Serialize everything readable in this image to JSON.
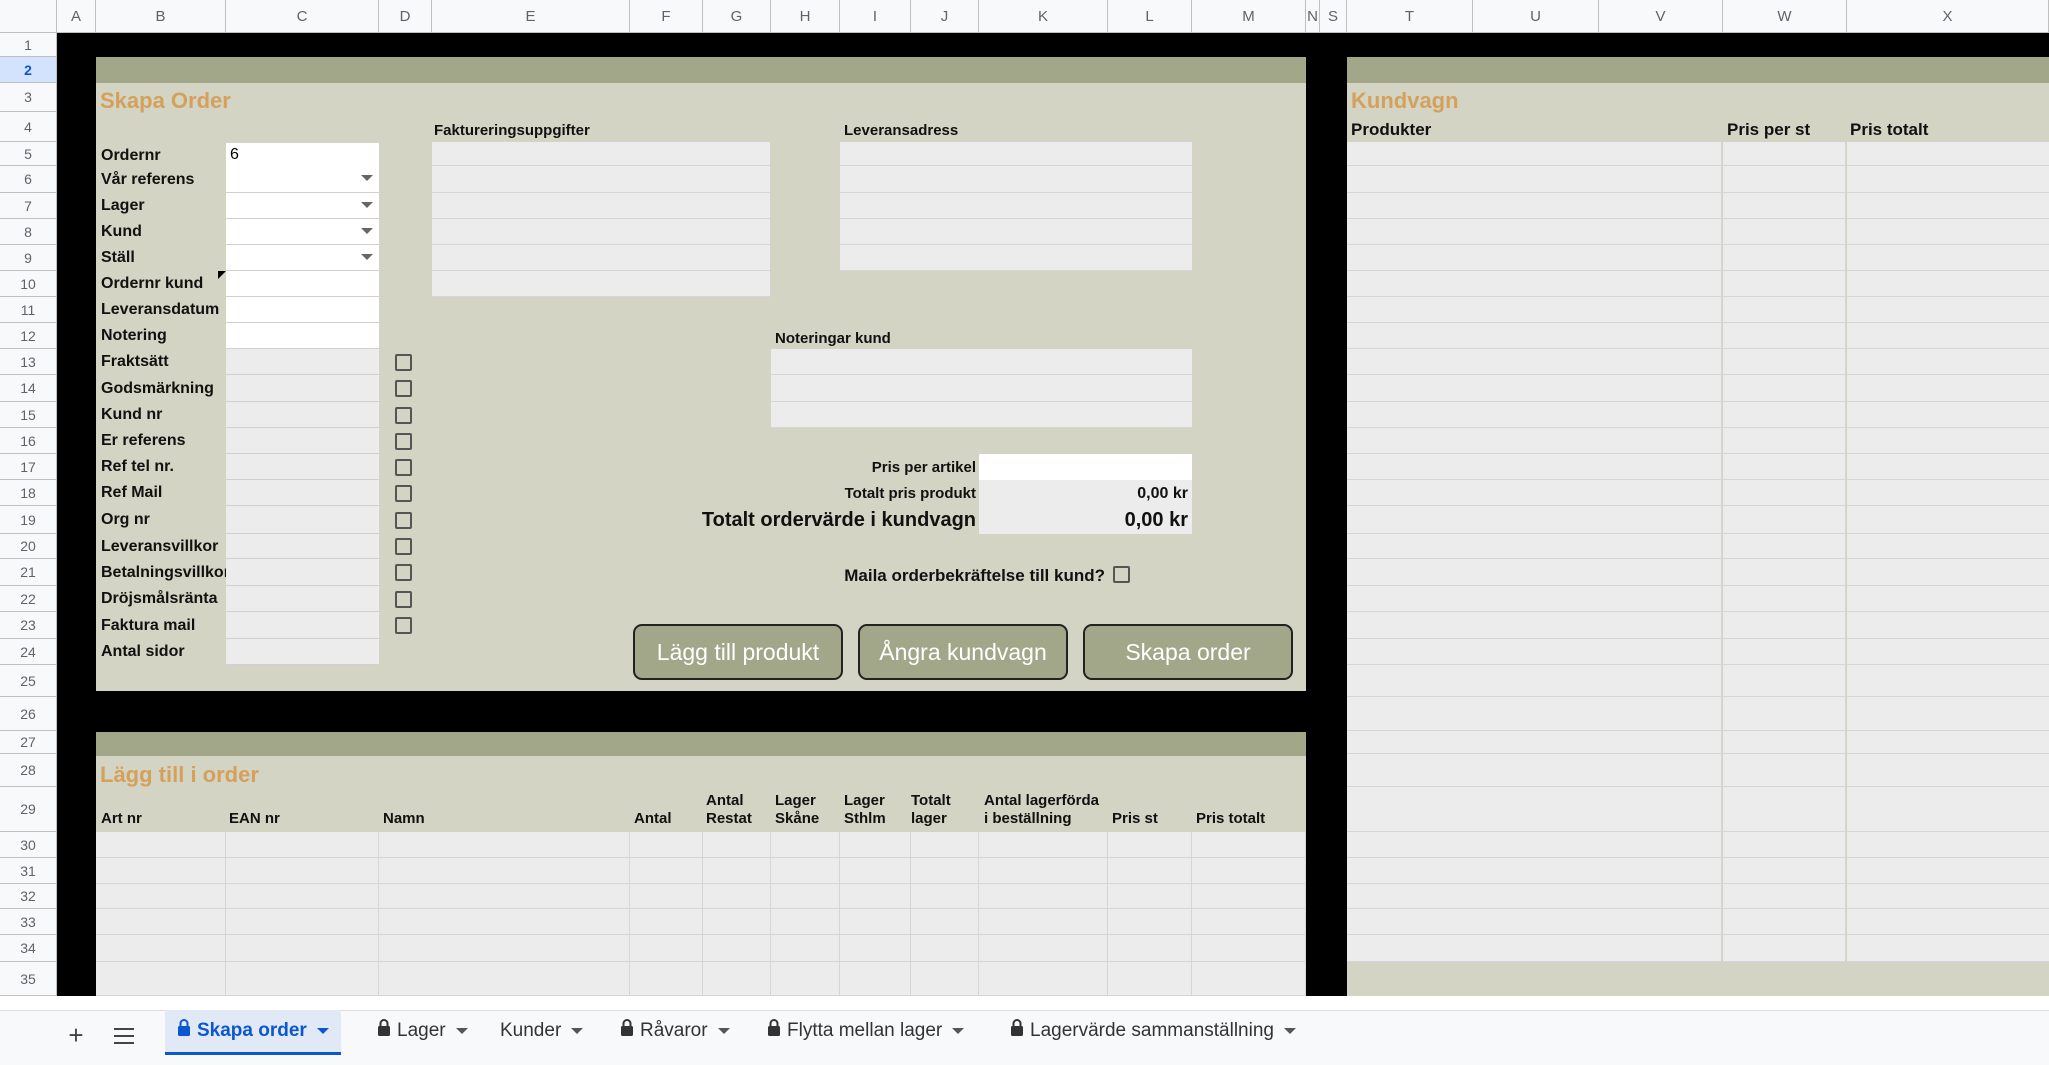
{
  "columns": [
    "A",
    "B",
    "C",
    "D",
    "E",
    "F",
    "G",
    "H",
    "I",
    "J",
    "K",
    "L",
    "M",
    "N",
    "S",
    "T",
    "U",
    "V",
    "W",
    "X"
  ],
  "rows": [
    "1",
    "2",
    "3",
    "4",
    "5",
    "6",
    "7",
    "8",
    "9",
    "10",
    "11",
    "12",
    "13",
    "14",
    "15",
    "16",
    "17",
    "18",
    "19",
    "20",
    "21",
    "22",
    "23",
    "24",
    "25",
    "26",
    "27",
    "28",
    "29",
    "30",
    "31",
    "32",
    "33",
    "34",
    "35"
  ],
  "skapa_order": {
    "title": "Skapa Order",
    "ordernr_label": "Ordernr",
    "ordernr_value": "6",
    "fields": [
      "Vår referens",
      "Lager",
      "Kund",
      "Ställ",
      "Ordernr kund",
      "Leveransdatum",
      "Notering",
      "Fraktsätt",
      "Godsmärkning",
      "Kund nr",
      "Er referens",
      "Ref tel nr.",
      "Ref Mail",
      "Org nr",
      "Leveransvillkor",
      "Betalningsvillkor",
      "Dröjsmålsränta",
      "Faktura mail",
      "Antal sidor"
    ],
    "faktura_label": "Faktureringsuppgifter",
    "leverans_label": "Leveransadress",
    "noteringar_label": "Noteringar kund",
    "pris_per_artikel_label": "Pris per artikel",
    "totalt_pris_produkt_label": "Totalt pris produkt",
    "totalt_pris_produkt_value": "0,00 kr",
    "totalt_ordervarde_label": "Totalt ordervärde i kundvagn",
    "totalt_ordervarde_value": "0,00 kr",
    "maila_label": "Maila orderbekräftelse till kund?",
    "btn_lagg_till": "Lägg till produkt",
    "btn_angra": "Ångra kundvagn",
    "btn_skapa": "Skapa order"
  },
  "kundvagn": {
    "title": "Kundvagn",
    "headers": [
      "Produkter",
      "Pris per st",
      "Pris totalt"
    ]
  },
  "lagg_till": {
    "title": "Lägg till i order",
    "headers": [
      "Art nr",
      "EAN nr",
      "Namn",
      "Antal",
      "Antal\nRestat",
      "Lager\nSkåne",
      "Lager\nSthlm",
      "Totalt\nlager",
      "Antal lagerförda\ni beställning",
      "Pris st",
      "Pris totalt"
    ]
  },
  "tabs": [
    {
      "label": "Skapa order",
      "locked": true,
      "active": true
    },
    {
      "label": "Lager",
      "locked": true,
      "active": false
    },
    {
      "label": "Kunder",
      "locked": false,
      "active": false
    },
    {
      "label": "Råvaror",
      "locked": true,
      "active": false
    },
    {
      "label": "Flytta mellan lager",
      "locked": true,
      "active": false
    },
    {
      "label": "Lagervärde sammanställning",
      "locked": true,
      "active": false
    }
  ],
  "colors": {
    "panel": "#d3d4c4",
    "panel_bar": "#a3a78a",
    "accent": "#d4a15c",
    "black": "#000000",
    "active_tab": "#0b57d0"
  }
}
